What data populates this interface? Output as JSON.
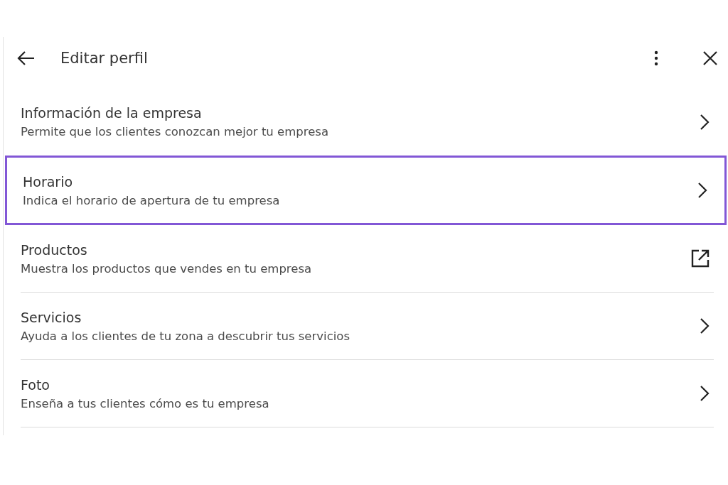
{
  "header": {
    "title": "Editar perfil"
  },
  "items": [
    {
      "title": "Información de la empresa",
      "subtitle": "Permite que los clientes conozcan mejor tu empresa",
      "kind": "chevron",
      "selected": false
    },
    {
      "title": "Horario",
      "subtitle": "Indica el horario de apertura de tu empresa",
      "kind": "chevron",
      "selected": true
    },
    {
      "title": "Productos",
      "subtitle": "Muestra los productos que vendes en tu empresa",
      "kind": "external",
      "selected": false
    },
    {
      "title": "Servicios",
      "subtitle": "Ayuda a los clientes de tu zona a descubrir tus servicios",
      "kind": "chevron",
      "selected": false
    },
    {
      "title": "Foto",
      "subtitle": "Enseña a tus clientes cómo es tu empresa",
      "kind": "chevron",
      "selected": false
    }
  ]
}
